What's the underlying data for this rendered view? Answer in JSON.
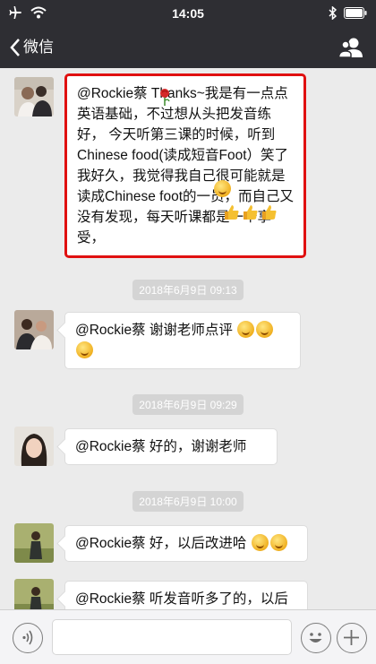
{
  "status_bar": {
    "time": "14:05"
  },
  "nav": {
    "back_label": "微信"
  },
  "messages": [
    {
      "text": "@Rockie蔡 Thanks~我是有一点点英语基础，不过想从头把发音练好， 今天听第三课的时候，听到Chinese food(读成短音Foot）笑了我好久，我觉得我自己很可能就是读成Chinese foot的一员，而自己又没有发现，每天听课都是一个享受，",
      "highlighted": true
    },
    {
      "text": "@Rockie蔡 谢谢老师点评"
    },
    {
      "text": "@Rockie蔡 好的，谢谢老师"
    },
    {
      "text": "@Rockie蔡 好，以后改进哈"
    },
    {
      "text": "@Rockie蔡 听发音听多了的，以后慢慢会有改进哈，一抹一抹"
    }
  ],
  "timestamps": [
    "2018年6月9日 09:13",
    "2018年6月9日 09:29",
    "2018年6月9日 10:00"
  ],
  "colors": {
    "nav_bg": "#2e2e33",
    "chat_bg": "#ebebeb",
    "highlight_border": "#e01010",
    "timestamp_bg": "#d4d4d4"
  },
  "icons": {
    "emoji": "grinning-face",
    "thumb": "thumbs-up",
    "rose": "rose"
  }
}
